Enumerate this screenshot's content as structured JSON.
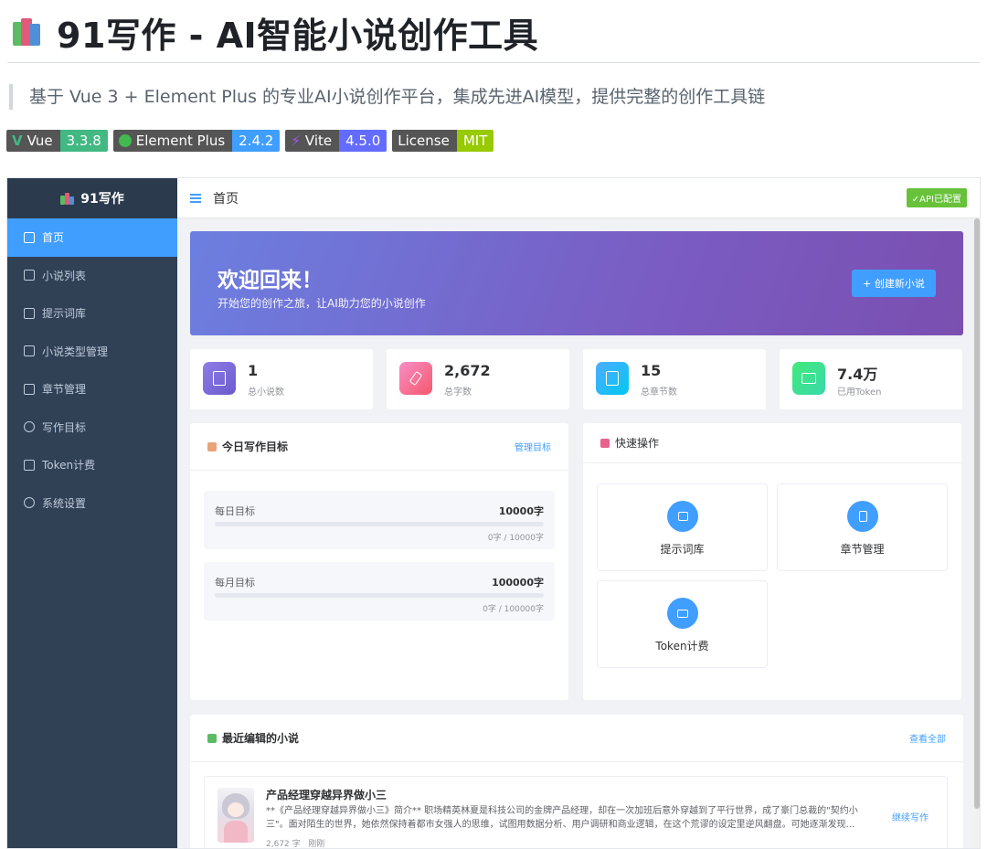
{
  "readme": {
    "title": "91写作 - AI智能小说创作工具",
    "quote": "基于 Vue 3 + Element Plus 的专业AI小说创作平台，集成先进AI模型，提供完整的创作工具链",
    "badges": [
      {
        "label": "Vue",
        "value": "3.3.8",
        "color": "#42b883",
        "icon": "vue-logo-icon"
      },
      {
        "label": "Element Plus",
        "value": "2.4.2",
        "color": "#409eff",
        "icon": "element-plus-logo-icon"
      },
      {
        "label": "Vite",
        "value": "4.5.0",
        "color": "#646cff",
        "icon": "vite-logo-icon"
      },
      {
        "label": "License",
        "value": "MIT",
        "color": "#97ca00",
        "icon": ""
      }
    ]
  },
  "app": {
    "logo": "91写作",
    "menu": [
      {
        "label": "首页",
        "icon": "home-icon",
        "active": true
      },
      {
        "label": "小说列表",
        "icon": "document-icon",
        "active": false
      },
      {
        "label": "提示词库",
        "icon": "message-icon",
        "active": false
      },
      {
        "label": "小说类型管理",
        "icon": "save-icon",
        "active": false
      },
      {
        "label": "章节管理",
        "icon": "notebook-icon",
        "active": false
      },
      {
        "label": "写作目标",
        "icon": "aim-icon",
        "active": false
      },
      {
        "label": "Token计费",
        "icon": "card-icon",
        "active": false
      },
      {
        "label": "系统设置",
        "icon": "gear-icon",
        "active": false
      }
    ],
    "topbar": {
      "crumb": "首页",
      "api_tag": "✓API已配置"
    },
    "welcome": {
      "title": "欢迎回来！",
      "subtitle": "开始您的创作之旅，让AI助力您的小说创作",
      "button": "+ 创建新小说"
    },
    "stats": [
      {
        "value": "1",
        "label": "总小说数",
        "color": "#7b6cd9"
      },
      {
        "value": "2,672",
        "label": "总字数",
        "color": "#f26d9c"
      },
      {
        "value": "15",
        "label": "总章节数",
        "color": "#2fb8f0"
      },
      {
        "value": "7.4万",
        "label": "已用Token",
        "color": "#3fdc8f"
      }
    ],
    "goals": {
      "title": "今日写作目标",
      "link": "管理目标",
      "items": [
        {
          "label": "每日目标",
          "value": "10000字",
          "progress": "0字 / 10000字",
          "fraction": 0
        },
        {
          "label": "每月目标",
          "value": "100000字",
          "progress": "0字 / 100000字",
          "fraction": 0
        }
      ]
    },
    "quick": {
      "title": "快速操作",
      "items": [
        {
          "label": "提示词库",
          "icon": "message-icon"
        },
        {
          "label": "章节管理",
          "icon": "notebook-icon"
        },
        {
          "label": "Token计费",
          "icon": "card-icon"
        }
      ]
    },
    "recent": {
      "title": "最近编辑的小说",
      "link": "查看全部",
      "novel": {
        "title": "产品经理穿越异界做小三",
        "desc": "**《产品经理穿越异界做小三》简介** 职场精英林夏是科技公司的金牌产品经理，却在一次加班后意外穿越到了平行世界，成了豪门总裁的\"契约小三\"。面对陌生的世界，她依然保持着都市女强人的思维，试图用数据分析、用户调研和商业逻辑，在这个荒谬的设定里逆风翻盘。可她逐渐发现...",
        "words": "2,672 字",
        "time": "刚刚",
        "action": "继续写作"
      }
    }
  }
}
